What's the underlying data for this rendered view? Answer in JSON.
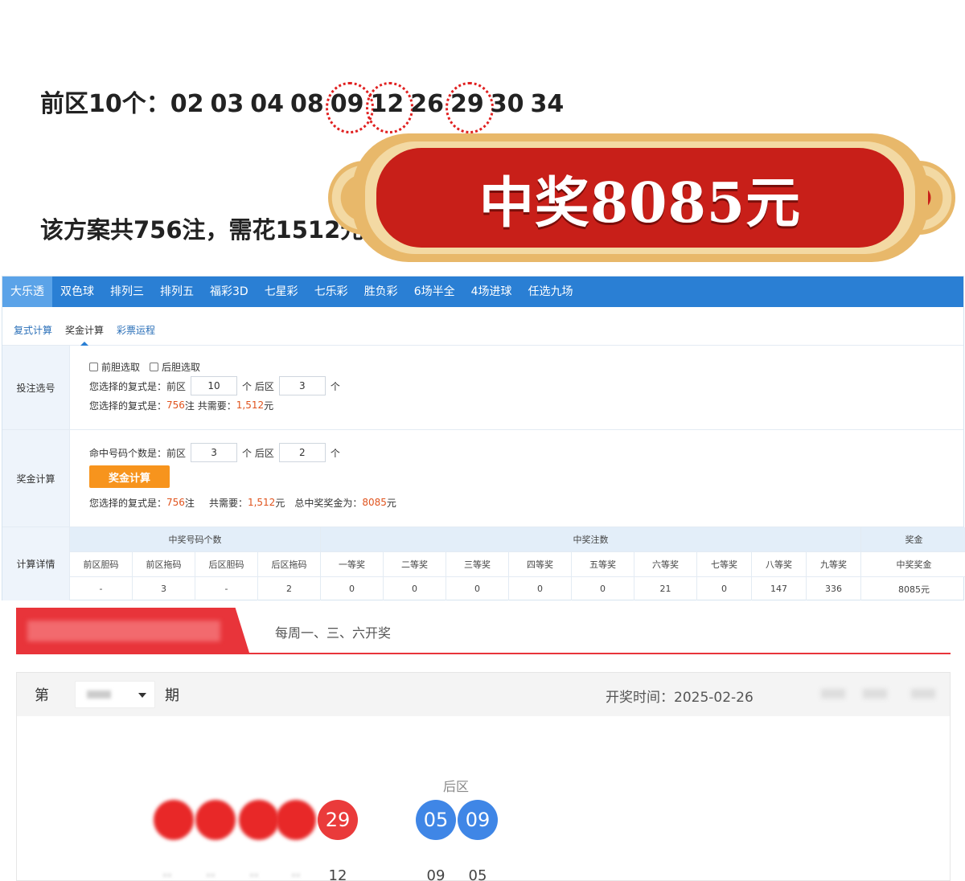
{
  "poster": {
    "front_prefix": "前区10个：",
    "front_numbers": [
      {
        "n": "02",
        "hl": false
      },
      {
        "n": "03",
        "hl": false
      },
      {
        "n": "04",
        "hl": false
      },
      {
        "n": "08",
        "hl": false
      },
      {
        "n": "09",
        "hl": true
      },
      {
        "n": "12",
        "hl": true
      },
      {
        "n": "26",
        "hl": false
      },
      {
        "n": "29",
        "hl": true
      },
      {
        "n": "30",
        "hl": false
      },
      {
        "n": "34",
        "hl": false
      }
    ],
    "plan_text": "该方案共756注，需花1512元",
    "prize_banner": "中奖8085元",
    "colors": {
      "banner_red": "#c81f19",
      "banner_gold": "#e8b86a",
      "highlight": "#e02020"
    }
  },
  "calculator": {
    "lottery_tabs": [
      {
        "label": "大乐透",
        "active": true
      },
      {
        "label": "双色球",
        "active": false
      },
      {
        "label": "排列三",
        "active": false
      },
      {
        "label": "排列五",
        "active": false
      },
      {
        "label": "福彩3D",
        "active": false
      },
      {
        "label": "七星彩",
        "active": false
      },
      {
        "label": "七乐彩",
        "active": false
      },
      {
        "label": "胜负彩",
        "active": false
      },
      {
        "label": "6场半全",
        "active": false
      },
      {
        "label": "4场进球",
        "active": false
      },
      {
        "label": "任选九场",
        "active": false
      }
    ],
    "func_tabs": [
      {
        "label": "复式计算",
        "active": false
      },
      {
        "label": "奖金计算",
        "active": true
      },
      {
        "label": "彩票运程",
        "active": false
      }
    ],
    "selection": {
      "label": "投注选号",
      "front_banker": "前胆选取",
      "back_banker": "后胆选取",
      "compound_prefix": "您选择的复式是：",
      "front_label": "前区",
      "front_value": "10",
      "unit_back": "个 后区",
      "back_value": "3",
      "unit": "个",
      "summary_prefix": "您选择的复式是：",
      "bets": "756",
      "bets_unit": "注 共需要：",
      "cost": "1,512",
      "currency": "元"
    },
    "prize": {
      "label": "奖金计算",
      "hit_prefix": "命中号码个数是：",
      "front_label": "前区",
      "front_hit": "3",
      "unit_back": "个 后区",
      "back_hit": "2",
      "unit": "个",
      "button": "奖金计算",
      "summary_prefix": "您选择的复式是：",
      "bets": "756",
      "bets_unit": "注",
      "cost_label": "共需要：",
      "cost": "1,512",
      "currency": "元",
      "total_label": "总中奖奖金为：",
      "total": "8085",
      "total_currency": "元"
    },
    "detail": {
      "label": "计算详情",
      "group_headers": [
        "中奖号码个数",
        "中奖注数",
        "奖金"
      ],
      "columns": [
        "前区胆码",
        "前区拖码",
        "后区胆码",
        "后区拖码",
        "一等奖",
        "二等奖",
        "三等奖",
        "四等奖",
        "五等奖",
        "六等奖",
        "七等奖",
        "八等奖",
        "九等奖",
        "中奖奖金"
      ],
      "values": [
        "-",
        "3",
        "-",
        "2",
        "0",
        "0",
        "0",
        "0",
        "0",
        "21",
        "0",
        "147",
        "336",
        "8085元"
      ]
    }
  },
  "results": {
    "schedule": "每周一、三、六开奖",
    "issue_prefix": "第",
    "issue_suffix": "期",
    "draw_time": "开奖时间：2025-02-26",
    "back_label": "后区",
    "front_visible_ball": "29",
    "back_balls": [
      "05",
      "09"
    ],
    "front_order_visible": "12",
    "back_order": [
      "09",
      "05"
    ],
    "colors": {
      "red_ball": "#ea3b3b",
      "blue_ball": "#3f86e6",
      "tab_red": "#e8343a"
    }
  }
}
